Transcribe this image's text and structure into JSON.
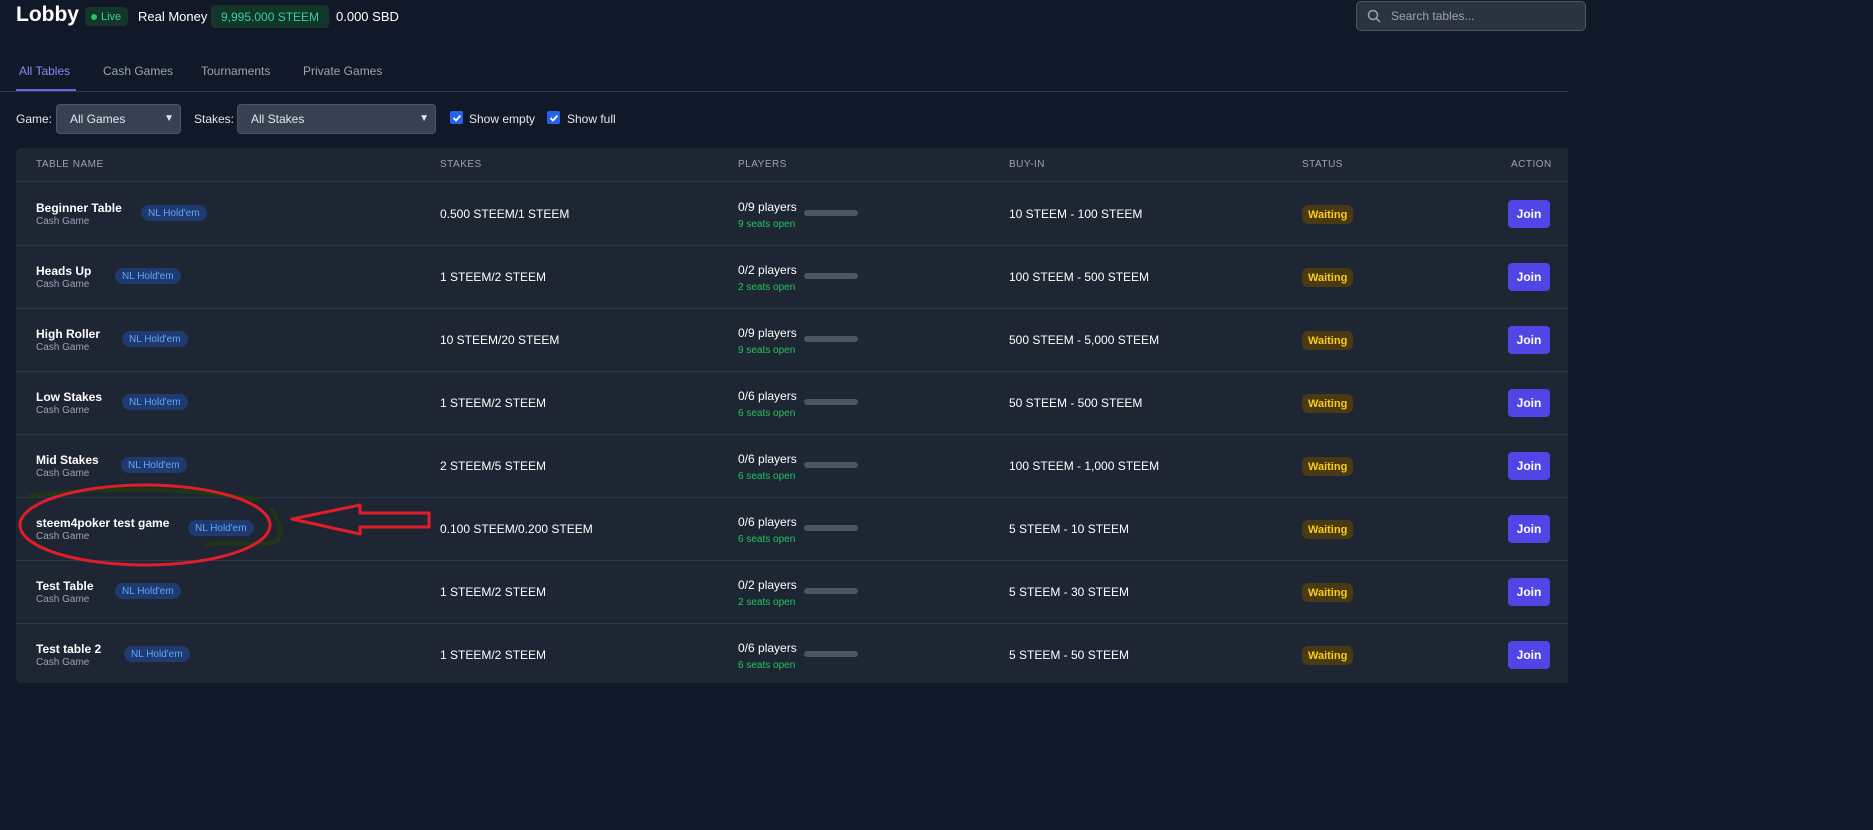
{
  "header": {
    "title": "Lobby",
    "live_label": "Live",
    "mode_label": "Real Money",
    "steem_balance": "9,995.000 STEEM",
    "sbd_balance": "0.000 SBD",
    "search_placeholder": "Search tables..."
  },
  "tabs": [
    {
      "label": "All Tables",
      "active": true
    },
    {
      "label": "Cash Games",
      "active": false
    },
    {
      "label": "Tournaments",
      "active": false
    },
    {
      "label": "Private Games",
      "active": false
    }
  ],
  "filters": {
    "game_label": "Game:",
    "game_value": "All Games",
    "stakes_label": "Stakes:",
    "stakes_value": "All Stakes",
    "show_empty_label": "Show empty",
    "show_empty_checked": true,
    "show_full_label": "Show full",
    "show_full_checked": true
  },
  "columns": [
    "TABLE NAME",
    "STAKES",
    "PLAYERS",
    "BUY-IN",
    "STATUS",
    "ACTION"
  ],
  "rows": [
    {
      "name": "Beginner Table",
      "type": "Cash Game",
      "tag": "NL Hold'em",
      "stakes": "0.500 STEEM/1 STEEM",
      "players": "0/9 players",
      "seats": "9 seats open",
      "fill": 0,
      "buyin": "10 STEEM - 100 STEEM",
      "status": "Waiting",
      "action": "Join"
    },
    {
      "name": "Heads Up",
      "type": "Cash Game",
      "tag": "NL Hold'em",
      "stakes": "1 STEEM/2 STEEM",
      "players": "0/2 players",
      "seats": "2 seats open",
      "fill": 0,
      "buyin": "100 STEEM - 500 STEEM",
      "status": "Waiting",
      "action": "Join"
    },
    {
      "name": "High Roller",
      "type": "Cash Game",
      "tag": "NL Hold'em",
      "stakes": "10 STEEM/20 STEEM",
      "players": "0/9 players",
      "seats": "9 seats open",
      "fill": 0,
      "buyin": "500 STEEM - 5,000 STEEM",
      "status": "Waiting",
      "action": "Join"
    },
    {
      "name": "Low Stakes",
      "type": "Cash Game",
      "tag": "NL Hold'em",
      "stakes": "1 STEEM/2 STEEM",
      "players": "0/6 players",
      "seats": "6 seats open",
      "fill": 0,
      "buyin": "50 STEEM - 500 STEEM",
      "status": "Waiting",
      "action": "Join"
    },
    {
      "name": "Mid Stakes",
      "type": "Cash Game",
      "tag": "NL Hold'em",
      "stakes": "2 STEEM/5 STEEM",
      "players": "0/6 players",
      "seats": "6 seats open",
      "fill": 0,
      "buyin": "100 STEEM - 1,000 STEEM",
      "status": "Waiting",
      "action": "Join"
    },
    {
      "name": "steem4poker test game",
      "type": "Cash Game",
      "tag": "NL Hold'em",
      "stakes": "0.100 STEEM/0.200 STEEM",
      "players": "0/6 players",
      "seats": "6 seats open",
      "fill": 0,
      "buyin": "5 STEEM - 10 STEEM",
      "status": "Waiting",
      "action": "Join"
    },
    {
      "name": "Test Table",
      "type": "Cash Game",
      "tag": "NL Hold'em",
      "stakes": "1 STEEM/2 STEEM",
      "players": "0/2 players",
      "seats": "2 seats open",
      "fill": 0,
      "buyin": "5 STEEM - 30 STEEM",
      "status": "Waiting",
      "action": "Join"
    },
    {
      "name": "Test table 2",
      "type": "Cash Game",
      "tag": "NL Hold'em",
      "stakes": "1 STEEM/2 STEEM",
      "players": "0/6 players",
      "seats": "6 seats open",
      "fill": 0,
      "buyin": "5 STEEM - 50 STEEM",
      "status": "Waiting",
      "action": "Join"
    }
  ],
  "annotation": {
    "highlighted_row": "steem4poker test game",
    "color": "#e11d2a"
  },
  "colors": {
    "accent": "#6366f1",
    "join_button": "#4f46e5",
    "waiting": "#facc15",
    "seats_open": "#22c55e"
  }
}
